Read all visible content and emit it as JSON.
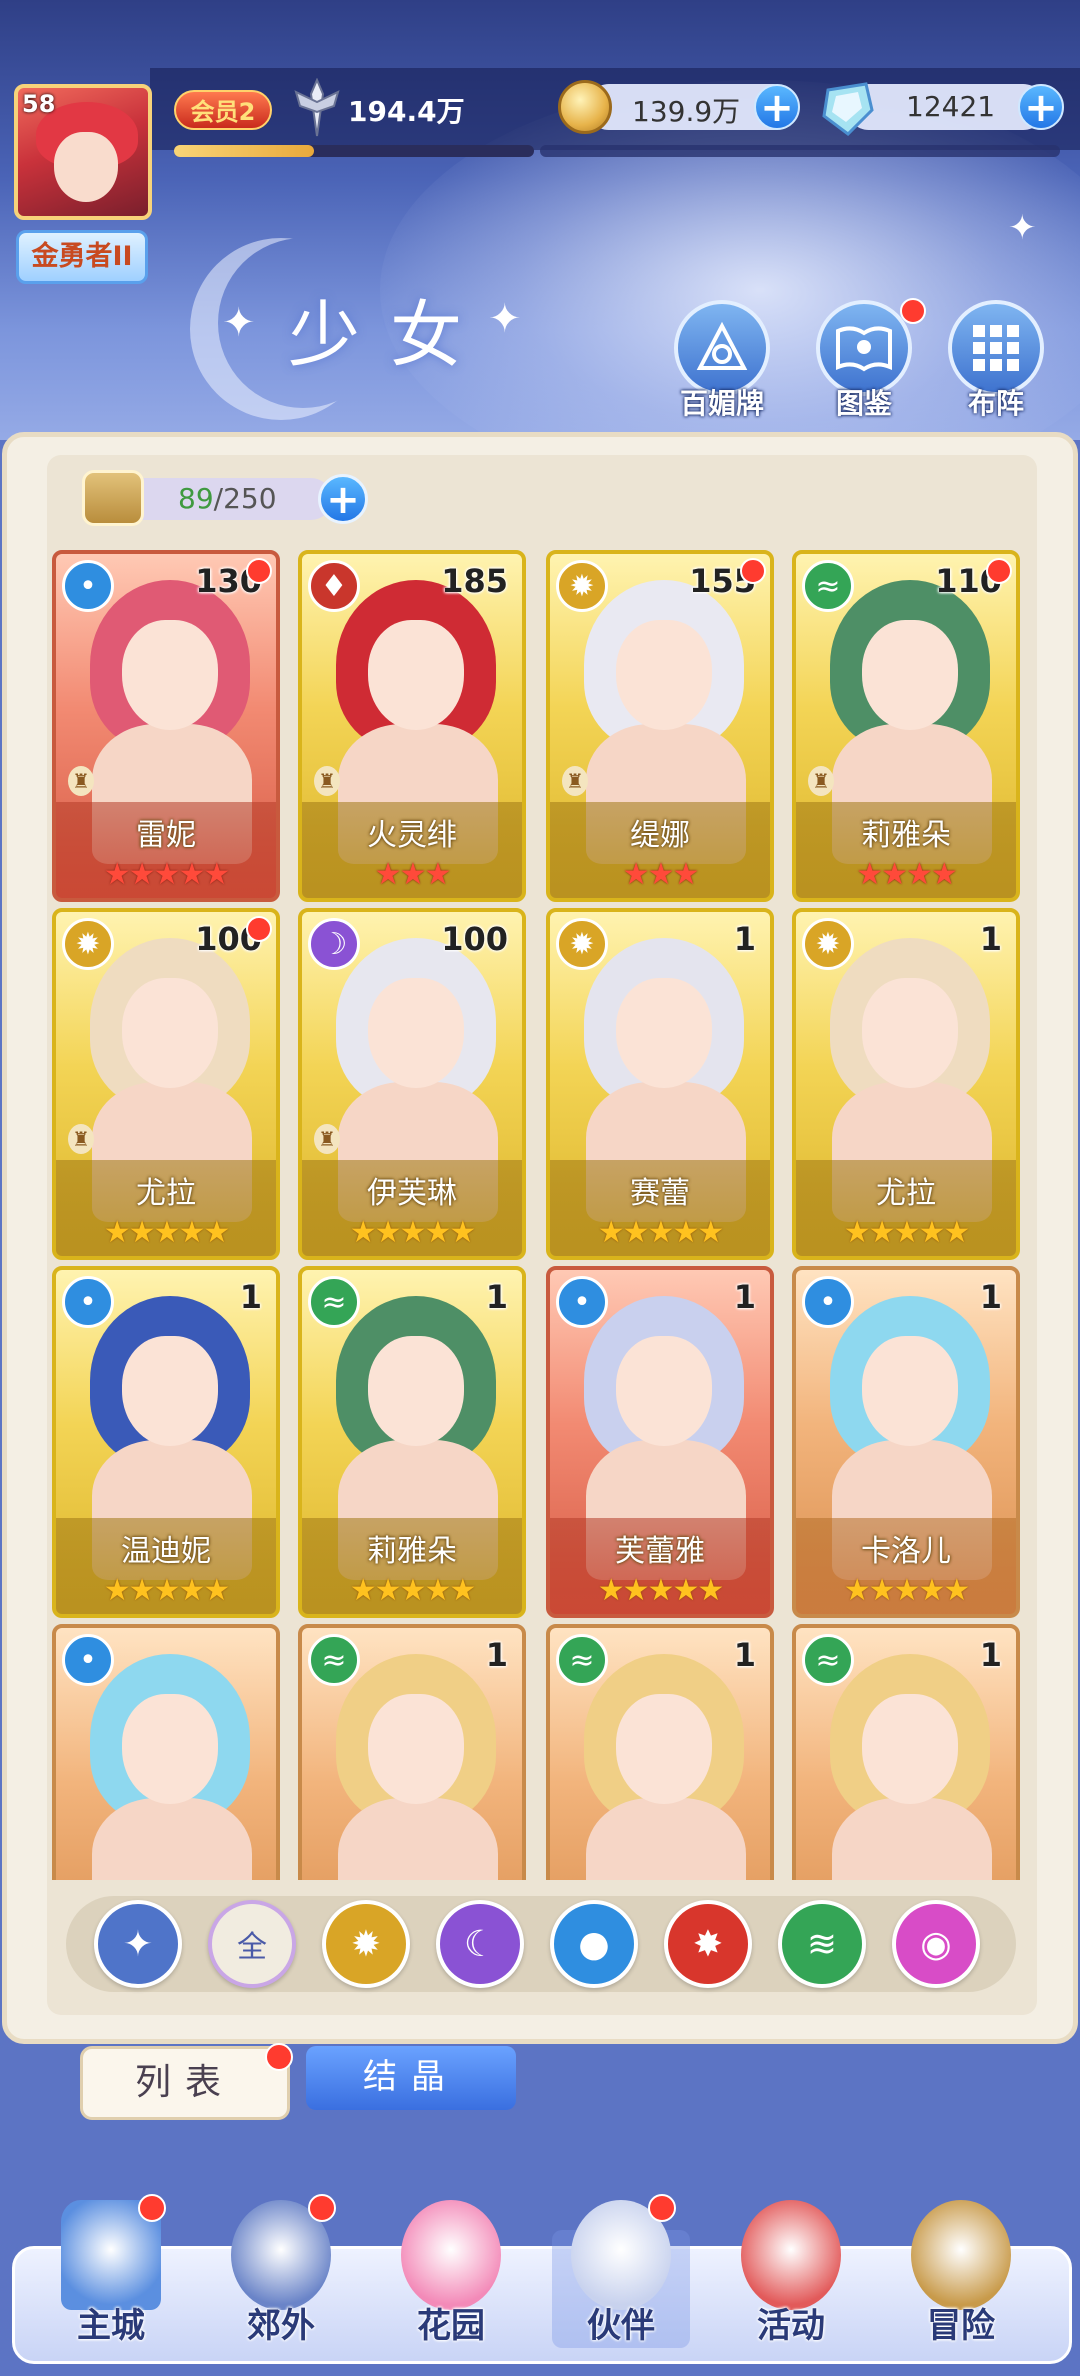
{
  "header": {
    "page_title": "少女",
    "avatar_level": "58",
    "rank_title": "金勇者II",
    "vip_label": "会员2",
    "power": "194.4万",
    "exp_progress": 0.39,
    "coins": "139.9万",
    "gems": "12421",
    "buttons": [
      {
        "label": "百媚牌",
        "icon": "card-deck-icon",
        "has_dot": false
      },
      {
        "label": "图鉴",
        "icon": "book-icon",
        "has_dot": true
      },
      {
        "label": "布阵",
        "icon": "formation-grid-icon",
        "has_dot": false
      }
    ]
  },
  "capacity": {
    "current": "89",
    "max": "/250"
  },
  "cards": [
    {
      "name": "雷妮",
      "level": "130",
      "element": "water",
      "rarity": "red",
      "stars": 5,
      "star_color": "red",
      "dot": true,
      "pawn": true,
      "hair": "#e05a74"
    },
    {
      "name": "火灵绯",
      "level": "185",
      "element": "fire",
      "rarity": "gold",
      "stars": 3,
      "star_color": "red",
      "dot": false,
      "pawn": true,
      "hair": "#cf2b34"
    },
    {
      "name": "缇娜",
      "level": "155",
      "element": "light",
      "rarity": "gold",
      "stars": 3,
      "star_color": "red",
      "dot": true,
      "pawn": true,
      "hair": "#e9e9f2"
    },
    {
      "name": "莉雅朵",
      "level": "110",
      "element": "wind",
      "rarity": "gold",
      "stars": 4,
      "star_color": "red",
      "dot": true,
      "pawn": true,
      "hair": "#4e8f66"
    },
    {
      "name": "尤拉",
      "level": "100",
      "element": "light",
      "rarity": "gold",
      "stars": 5,
      "star_color": "gold",
      "dot": true,
      "pawn": true,
      "hair": "#efdcc0"
    },
    {
      "name": "伊芙琳",
      "level": "100",
      "element": "dark",
      "rarity": "gold",
      "stars": 5,
      "star_color": "gold",
      "dot": false,
      "pawn": true,
      "hair": "#e7e7ef"
    },
    {
      "name": "赛蕾",
      "level": "1",
      "element": "light",
      "rarity": "gold",
      "stars": 5,
      "star_color": "gold",
      "dot": false,
      "pawn": false,
      "hair": "#e4e4ee"
    },
    {
      "name": "尤拉",
      "level": "1",
      "element": "light",
      "rarity": "gold",
      "stars": 5,
      "star_color": "gold",
      "dot": false,
      "pawn": false,
      "hair": "#efdcc0"
    },
    {
      "name": "温迪妮",
      "level": "1",
      "element": "water",
      "rarity": "gold",
      "stars": 5,
      "star_color": "gold",
      "dot": false,
      "pawn": false,
      "hair": "#3a5ab8"
    },
    {
      "name": "莉雅朵",
      "level": "1",
      "element": "wind",
      "rarity": "gold",
      "stars": 5,
      "star_color": "gold",
      "dot": false,
      "pawn": false,
      "hair": "#4e8f66"
    },
    {
      "name": "芙蕾雅",
      "level": "1",
      "element": "water",
      "rarity": "red",
      "stars": 5,
      "star_color": "gold",
      "dot": false,
      "pawn": false,
      "hair": "#c9d0ee"
    },
    {
      "name": "卡洛儿",
      "level": "1",
      "element": "water",
      "rarity": "orange",
      "stars": 5,
      "star_color": "gold",
      "dot": false,
      "pawn": false,
      "hair": "#8ed8ef"
    },
    {
      "name": "",
      "level": "",
      "element": "water",
      "rarity": "orange",
      "stars": 0,
      "star_color": "gold",
      "dot": false,
      "pawn": false,
      "hair": "#8ed8ef"
    },
    {
      "name": "",
      "level": "1",
      "element": "wind",
      "rarity": "orange",
      "stars": 0,
      "star_color": "gold",
      "dot": false,
      "pawn": false,
      "hair": "#f0cf86"
    },
    {
      "name": "",
      "level": "1",
      "element": "wind",
      "rarity": "orange",
      "stars": 0,
      "star_color": "gold",
      "dot": false,
      "pawn": false,
      "hair": "#f0cf86"
    },
    {
      "name": "",
      "level": "1",
      "element": "wind",
      "rarity": "orange",
      "stars": 0,
      "star_color": "gold",
      "dot": false,
      "pawn": false,
      "hair": "#f0cf86"
    }
  ],
  "filters": [
    {
      "name": "filter-all-elements-icon",
      "label": "",
      "color": "#4f74c9"
    },
    {
      "name": "filter-all-button",
      "label": "全",
      "color": "#f1ece0"
    },
    {
      "name": "filter-light-icon",
      "label": "",
      "color": "#d9a526"
    },
    {
      "name": "filter-dark-icon",
      "label": "",
      "color": "#8a52d4"
    },
    {
      "name": "filter-water-icon",
      "label": "",
      "color": "#2f8ee0"
    },
    {
      "name": "filter-fire-icon",
      "label": "",
      "color": "#d8362c"
    },
    {
      "name": "filter-wind-icon",
      "label": "",
      "color": "#34a556"
    },
    {
      "name": "filter-special-icon",
      "label": "",
      "color": "#d84cc7"
    }
  ],
  "tabs": {
    "list": "列表",
    "crystal": "结晶"
  },
  "nav": [
    {
      "label": "主城",
      "icon": "castle-icon",
      "dot": true
    },
    {
      "label": "郊外",
      "icon": "portal-icon",
      "dot": true
    },
    {
      "label": "花园",
      "icon": "heart-garden-icon",
      "dot": false
    },
    {
      "label": "伙伴",
      "icon": "partner-portrait-icon",
      "dot": true
    },
    {
      "label": "活动",
      "icon": "gift-box-icon",
      "dot": false
    },
    {
      "label": "冒险",
      "icon": "compass-icon",
      "dot": false
    }
  ],
  "colors": {
    "water": "#2f8ee0",
    "fire": "#c9362c",
    "light": "#d9a526",
    "wind": "#34a556",
    "dark": "#8a52d4"
  }
}
